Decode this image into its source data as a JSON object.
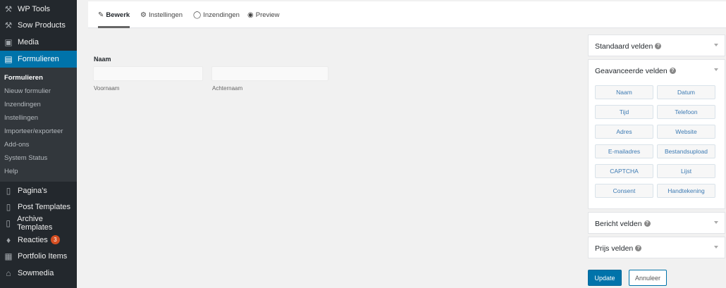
{
  "sidebar": {
    "top_items": [
      {
        "label": "WP Tools",
        "icon": "wrench-icon"
      },
      {
        "label": "Sow Products",
        "icon": "wrench-icon"
      },
      {
        "label": "Media",
        "icon": "media-icon"
      },
      {
        "label": "Formulieren",
        "icon": "forms-icon"
      }
    ],
    "submenu": [
      {
        "label": "Formulieren"
      },
      {
        "label": "Nieuw formulier"
      },
      {
        "label": "Inzendingen"
      },
      {
        "label": "Instellingen"
      },
      {
        "label": "Importeer/exporteer"
      },
      {
        "label": "Add-ons"
      },
      {
        "label": "System Status"
      },
      {
        "label": "Help"
      }
    ],
    "bottom_items": [
      {
        "label": "Pagina's",
        "icon": "page-icon"
      },
      {
        "label": "Post Templates",
        "icon": "page-icon"
      },
      {
        "label": "Archive Templates",
        "icon": "page-icon"
      },
      {
        "label": "Reacties",
        "icon": "comment-icon",
        "badge": "3"
      },
      {
        "label": "Portfolio Items",
        "icon": "portfolio-icon"
      },
      {
        "label": "Sowmedia",
        "icon": "home-icon"
      }
    ]
  },
  "tabs": [
    {
      "label": "Bewerk",
      "icon": "edit-icon"
    },
    {
      "label": "Instellingen",
      "icon": "gears-icon"
    },
    {
      "label": "Inzendingen",
      "icon": "speech-bubble-icon"
    },
    {
      "label": "Preview",
      "icon": "eye-icon"
    }
  ],
  "form": {
    "field_label": "Naam",
    "first_name_sublabel": "Voornaam",
    "last_name_sublabel": "Achternaam"
  },
  "panels": {
    "standard": "Standaard velden",
    "advanced": "Geavanceerde velden",
    "post": "Bericht velden",
    "pricing": "Prijs velden",
    "help_glyph": "?",
    "advanced_buttons": [
      "Naam",
      "Datum",
      "Tijd",
      "Telefoon",
      "Adres",
      "Website",
      "E-mailadres",
      "Bestandsupload",
      "CAPTCHA",
      "Lijst",
      "Consent",
      "Handtekening"
    ]
  },
  "actions": {
    "update": "Update",
    "cancel": "Annuleer"
  },
  "colors": {
    "sidebar_bg": "#23282d",
    "accent": "#0073aa",
    "badge": "#d54e21"
  }
}
